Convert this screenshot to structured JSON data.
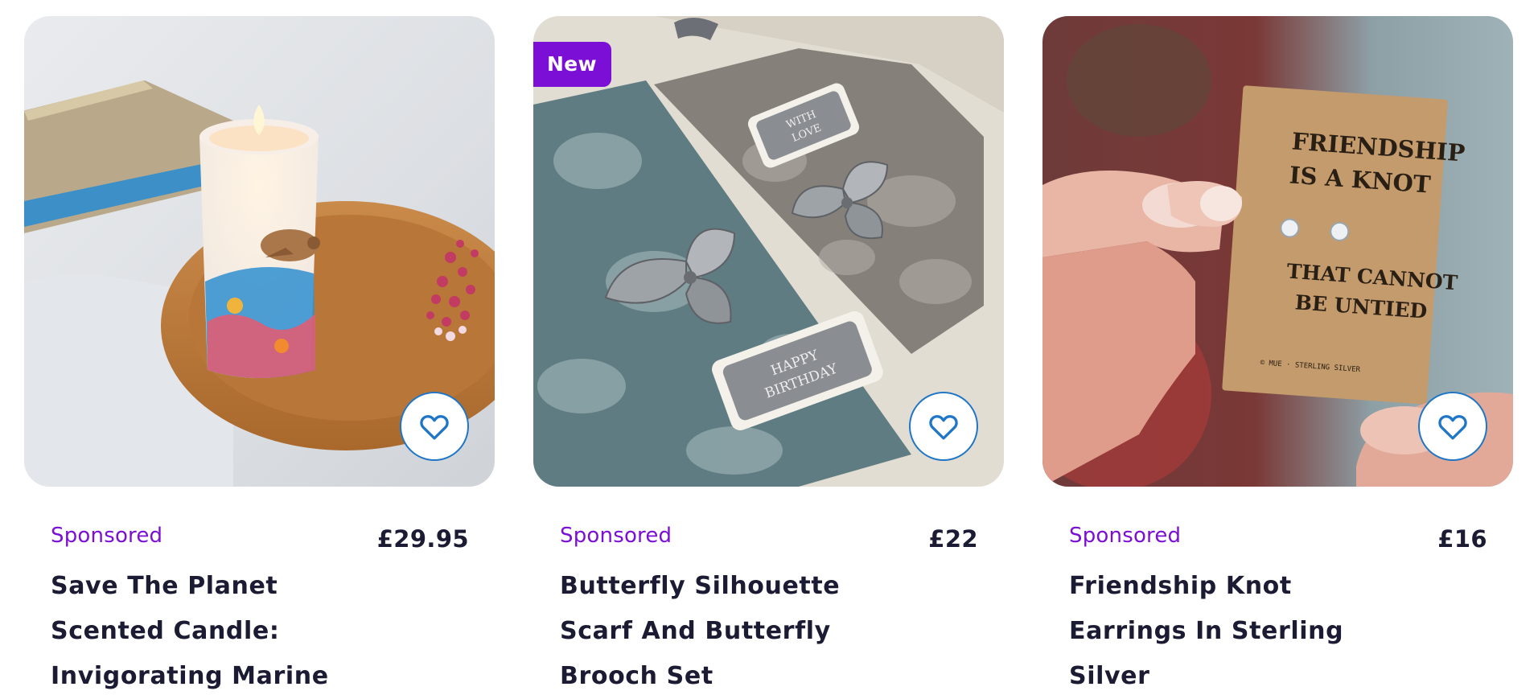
{
  "products": [
    {
      "badge": "",
      "sponsored_label": "Sponsored",
      "price": "£29.95",
      "title_lines": [
        "Save The Planet",
        "Scented Candle:",
        "Invigorating Marine"
      ],
      "favourite_icon": "heart-outline-icon"
    },
    {
      "badge": "New",
      "sponsored_label": "Sponsored",
      "price": "£22",
      "title_lines": [
        "Butterfly Silhouette",
        "Scarf And Butterfly",
        "Brooch Set"
      ],
      "favourite_icon": "heart-outline-icon",
      "photo_text": {
        "tag_small": [
          "WITH",
          "LOVE"
        ],
        "tag_large": [
          "HAPPY",
          "BIRTHDAY"
        ]
      }
    },
    {
      "badge": "",
      "sponsored_label": "Sponsored",
      "price": "£16",
      "title_lines": [
        "Friendship Knot",
        "Earrings In Sterling",
        "Silver"
      ],
      "favourite_icon": "heart-outline-icon",
      "photo_text": {
        "card_lines_top": [
          "FRIENDSHIP",
          "IS A KNOT"
        ],
        "card_lines_bottom": [
          "THAT CANNOT",
          "BE UNTIED"
        ],
        "card_footer": "© MUE · STERLING SILVER"
      }
    }
  ],
  "colors": {
    "accent_purple": "#7c0fd6",
    "heart_blue": "#1f76c7",
    "text_dark": "#1b1b33"
  }
}
